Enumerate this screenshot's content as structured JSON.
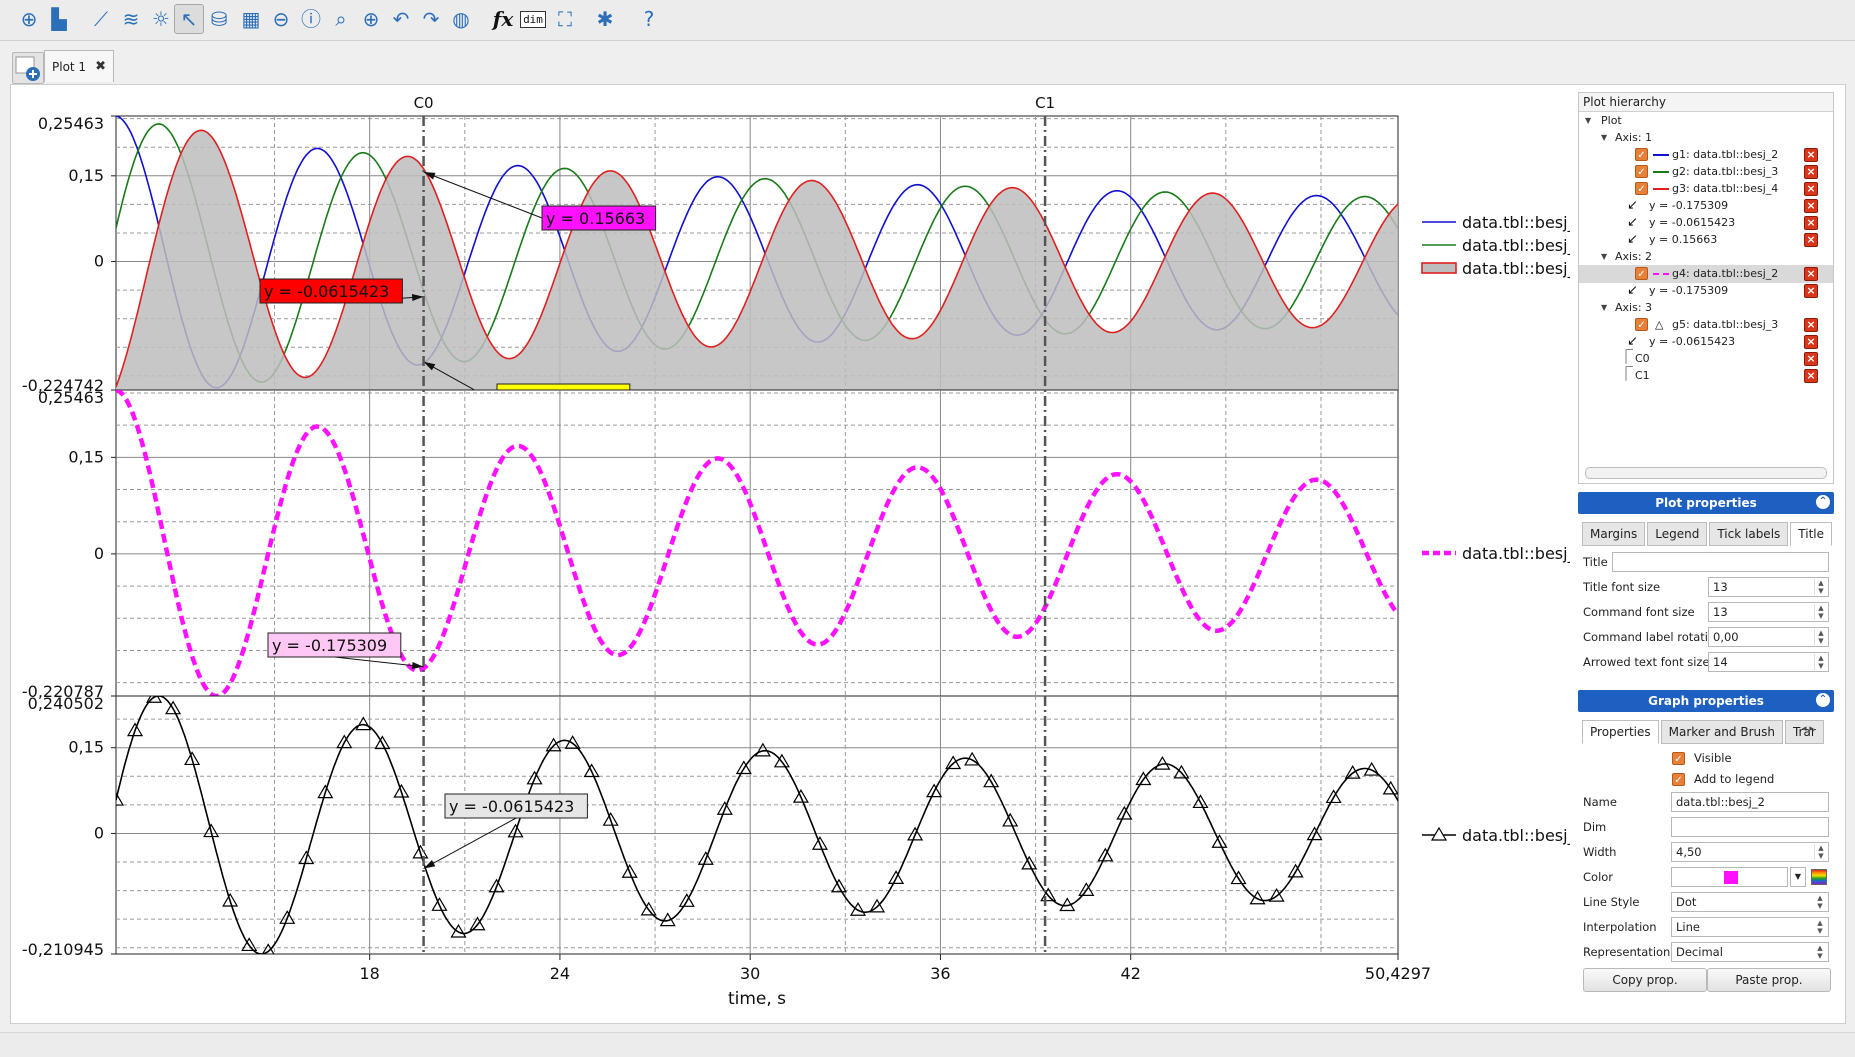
{
  "toolbar": {
    "items": [
      {
        "icon": "add-plot-icon",
        "glyph": "⊕"
      },
      {
        "icon": "add-curve-icon",
        "glyph": "▙"
      },
      {
        "icon": "line-chart-icon",
        "glyph": "⟋"
      },
      {
        "icon": "multi-line-chart-icon",
        "glyph": "≋"
      },
      {
        "icon": "lightbulb-icon",
        "glyph": "☼"
      },
      {
        "icon": "pointer-icon",
        "glyph": "↖"
      },
      {
        "icon": "database-icon",
        "glyph": "⛁"
      },
      {
        "icon": "table-icon",
        "glyph": "▦"
      },
      {
        "icon": "zoom-out-icon",
        "glyph": "⊖"
      },
      {
        "icon": "info-icon",
        "glyph": "ⓘ"
      },
      {
        "icon": "zoom-icon",
        "glyph": "⌕"
      },
      {
        "icon": "zoom-in-icon",
        "glyph": "⊕"
      },
      {
        "icon": "undo-icon",
        "glyph": "↶"
      },
      {
        "icon": "redo-icon",
        "glyph": "↷"
      },
      {
        "icon": "globe-icon",
        "glyph": "◍"
      },
      {
        "icon": "function-icon",
        "text": "fx"
      },
      {
        "icon": "dimension-icon",
        "text": "dim"
      },
      {
        "icon": "fit-icon",
        "glyph": "⛶"
      },
      {
        "icon": "settings-icon",
        "glyph": "✱"
      },
      {
        "icon": "help-icon",
        "glyph": "?"
      }
    ]
  },
  "tabs": {
    "active": "Plot 1"
  },
  "chart_data": {
    "type": "line",
    "xlabel": "time, s",
    "x_ticks": [
      "18",
      "24",
      "30",
      "36",
      "42",
      "50,4297"
    ],
    "xlim": [
      10.0,
      50.4297
    ],
    "cursors": [
      {
        "name": "C0",
        "x": 19.7
      },
      {
        "name": "C1",
        "x": 39.3
      }
    ],
    "panels": [
      {
        "name": "axis-1",
        "ylim": [
          -0.224742,
          0.25463
        ],
        "y_ticks": [
          "0,25463",
          "0,15",
          "0",
          "-0,224742"
        ],
        "series": [
          {
            "name": "data.tbl::besj_2",
            "color": "#1010d0",
            "style": "solid"
          },
          {
            "name": "data.tbl::besj_3",
            "color": "#1a7a1a",
            "style": "solid"
          },
          {
            "name": "data.tbl::besj_4",
            "color": "#e02020",
            "style": "solid",
            "fill": "#bdbdbd"
          }
        ],
        "annotations": [
          {
            "text": "y = 0.15663",
            "bg": "#ff10ff",
            "x": 19.7,
            "y": 0.15663
          },
          {
            "text": "y = -0.0615423",
            "bg": "#ff0000",
            "x": 19.7,
            "y": -0.0615423
          },
          {
            "text": "y = -0.175309",
            "bg": "#ffff00",
            "x": 19.7,
            "y": -0.175309
          }
        ]
      },
      {
        "name": "axis-2",
        "ylim": [
          -0.220787,
          0.25463
        ],
        "y_ticks": [
          "0,25463",
          "0,15",
          "0",
          "-0,220787"
        ],
        "series": [
          {
            "name": "data.tbl::besj_2",
            "color": "#ff10ff",
            "style": "dashed"
          }
        ],
        "annotations": [
          {
            "text": "y = -0.175309",
            "bg": "#ffc8f4",
            "x": 19.7,
            "y": -0.175309
          }
        ]
      },
      {
        "name": "axis-3",
        "ylim": [
          -0.210945,
          0.240502
        ],
        "y_ticks": [
          "0,240502",
          "0,15",
          "0",
          "-0,210945"
        ],
        "series": [
          {
            "name": "data.tbl::besj_3",
            "color": "#000000",
            "style": "triangle-markers"
          }
        ],
        "annotations": [
          {
            "text": "y = -0.0615423",
            "bg": "#e6e6e6",
            "x": 19.7,
            "y": -0.0615423
          }
        ]
      }
    ]
  },
  "hierarchy": {
    "header": "Plot hierarchy",
    "root": "Plot",
    "rows": [
      {
        "label": "Axis: 1",
        "kind": "axis"
      },
      {
        "label": "g1: data.tbl::besj_2",
        "kind": "graph",
        "color": "#1010d0",
        "dash": false
      },
      {
        "label": "g2: data.tbl::besj_3",
        "kind": "graph",
        "color": "#1a7a1a",
        "dash": false
      },
      {
        "label": "g3: data.tbl::besj_4",
        "kind": "graph",
        "color": "#e02020",
        "dash": false
      },
      {
        "label": "y = -0.175309",
        "kind": "arrow"
      },
      {
        "label": "y = -0.0615423",
        "kind": "arrow"
      },
      {
        "label": "y = 0.15663",
        "kind": "arrow"
      },
      {
        "label": "Axis: 2",
        "kind": "axis"
      },
      {
        "label": "g4: data.tbl::besj_2",
        "kind": "graph",
        "color": "#ff10ff",
        "dash": true,
        "selected": true
      },
      {
        "label": "y = -0.175309",
        "kind": "arrow"
      },
      {
        "label": "Axis: 3",
        "kind": "axis"
      },
      {
        "label": "g5: data.tbl::besj_3",
        "kind": "graph-marker"
      },
      {
        "label": "y = -0.0615423",
        "kind": "arrow"
      },
      {
        "label": "C0",
        "kind": "cursor"
      },
      {
        "label": "C1",
        "kind": "cursor"
      }
    ]
  },
  "plot_properties": {
    "title": "Plot properties",
    "tabs": [
      "Margins",
      "Legend",
      "Tick labels",
      "Title"
    ],
    "active_tab": "Title",
    "fields": [
      {
        "label": "Title",
        "value": ""
      },
      {
        "label": "Title font size",
        "value": "13"
      },
      {
        "label": "Command font size",
        "value": "13"
      },
      {
        "label": "Command label rotation",
        "value": "0,00"
      },
      {
        "label": "Arrowed text font size",
        "value": "14"
      }
    ]
  },
  "graph_properties": {
    "title": "Graph properties",
    "tabs": [
      "Properties",
      "Marker and Brush",
      "Trar"
    ],
    "active_tab": "Properties",
    "visible_label": "Visible",
    "legend_label": "Add to legend",
    "fields": {
      "name_label": "Name",
      "name_value": "data.tbl::besj_2",
      "dim_label": "Dim",
      "dim_value": "",
      "width_label": "Width",
      "width_value": "4,50",
      "color_label": "Color",
      "color_value": "#ff10ff",
      "linestyle_label": "Line Style",
      "linestyle_value": "Dot",
      "interp_label": "Interpolation",
      "interp_value": "Line",
      "repr_label": "Representation",
      "repr_value": "Decimal"
    },
    "copy_label": "Copy prop.",
    "paste_label": "Paste prop."
  }
}
